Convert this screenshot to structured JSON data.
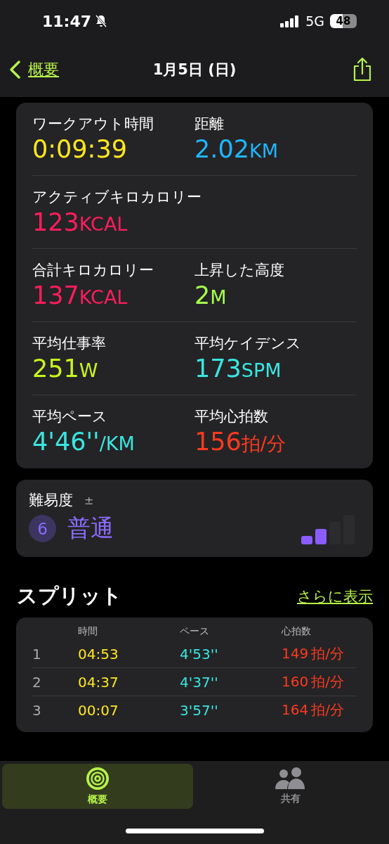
{
  "status_bar": {
    "time": "11:47",
    "network": "5G",
    "battery": "48"
  },
  "nav": {
    "back": "概要",
    "title": "1月5日 (日)"
  },
  "metrics": [
    [
      {
        "label": "ワークアウト時間",
        "value": "0:09:39",
        "color": "#ffe620"
      },
      {
        "label": "距離",
        "value": "2.02",
        "unit": "KM",
        "color": "#1fb6ff"
      }
    ],
    [
      {
        "label": "アクティブキロカロリー",
        "value": "123",
        "unit": "KCAL",
        "color": "#ff1d5c"
      }
    ],
    [
      {
        "label": "合計キロカロリー",
        "value": "137",
        "unit": "KCAL",
        "color": "#ff1d5c"
      },
      {
        "label": "上昇した高度",
        "value": "2",
        "unit": "M",
        "color": "#a6ff4d"
      }
    ],
    [
      {
        "label": "平均仕事率",
        "value": "251",
        "unit": "W",
        "color": "#c8f51e"
      },
      {
        "label": "平均ケイデンス",
        "value": "173",
        "unit": "SPM",
        "color": "#3ae6e0"
      }
    ],
    [
      {
        "label": "平均ペース",
        "value": "4'46''",
        "unit": "/KM",
        "color": "#3ae6e0"
      },
      {
        "label": "平均心拍数",
        "value": "156",
        "unit": "拍/分",
        "color": "#ff3a1f"
      }
    ]
  ],
  "difficulty": {
    "label": "難易度",
    "adjust": "±",
    "score": "6",
    "rating": "普通",
    "level": 0.5
  },
  "splits": {
    "title": "スプリット",
    "more": "さらに表示",
    "columns": [
      "時間",
      "ペース",
      "心拍数"
    ],
    "rows": [
      {
        "index": "1",
        "time": "04:53",
        "pace": "4'53''",
        "heart_rate": "149",
        "unit": "拍/分"
      },
      {
        "index": "2",
        "time": "04:37",
        "pace": "4'37''",
        "heart_rate": "160",
        "unit": "拍/分"
      },
      {
        "index": "3",
        "time": "00:07",
        "pace": "3'57''",
        "heart_rate": "164",
        "unit": "拍/分"
      }
    ]
  },
  "tabs": [
    {
      "label": "概要",
      "selected": true
    },
    {
      "label": "共有",
      "selected": false
    }
  ]
}
